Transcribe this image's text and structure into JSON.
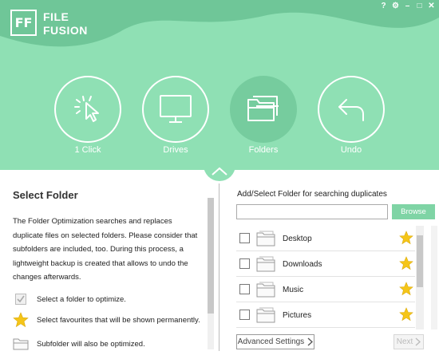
{
  "app": {
    "logo_mark": "FF",
    "logo_line1": "FILE",
    "logo_line2": "FUSION"
  },
  "window_controls": [
    {
      "icon": "help-icon",
      "glyph": "?"
    },
    {
      "icon": "gear-icon",
      "glyph": "⚙"
    },
    {
      "icon": "minimize-icon",
      "glyph": "–"
    },
    {
      "icon": "maximize-icon",
      "glyph": "□"
    },
    {
      "icon": "close-icon",
      "glyph": "✕"
    }
  ],
  "nav": [
    {
      "label": "1 Click",
      "icon": "cursor-click-icon",
      "active": false
    },
    {
      "label": "Drives",
      "icon": "monitor-icon",
      "active": false
    },
    {
      "label": "Folders",
      "icon": "folders-icon",
      "active": true
    },
    {
      "label": "Undo",
      "icon": "undo-icon",
      "active": false
    }
  ],
  "left": {
    "title": "Select Folder",
    "description": "The Folder Optimization searches and replaces duplicate files on selected folders. Please consider that subfolders are included, too. During this process, a lightweight backup is created that allows to undo the changes afterwards.",
    "legend": [
      {
        "icon": "checkbox-checked-icon",
        "text": "Select a folder to optimize."
      },
      {
        "icon": "star-icon",
        "text": "Select favourites that will be shown permanently."
      },
      {
        "icon": "folder-icon",
        "text": "Subfolder will also be optimized."
      }
    ]
  },
  "right": {
    "title": "Add/Select Folder for searching duplicates",
    "path_value": "",
    "browse_label": "Browse",
    "folders": [
      {
        "name": "Desktop",
        "checked": false,
        "favourite": true
      },
      {
        "name": "Downloads",
        "checked": false,
        "favourite": true
      },
      {
        "name": "Music",
        "checked": false,
        "favourite": true
      },
      {
        "name": "Pictures",
        "checked": false,
        "favourite": true
      }
    ],
    "advanced_label": "Advanced Settings",
    "next_label": "Next"
  },
  "colors": {
    "header_bg": "#8fe0b4",
    "header_dark": "#76cc9e",
    "accent": "#7fd4a5",
    "star": "#f5c518"
  }
}
